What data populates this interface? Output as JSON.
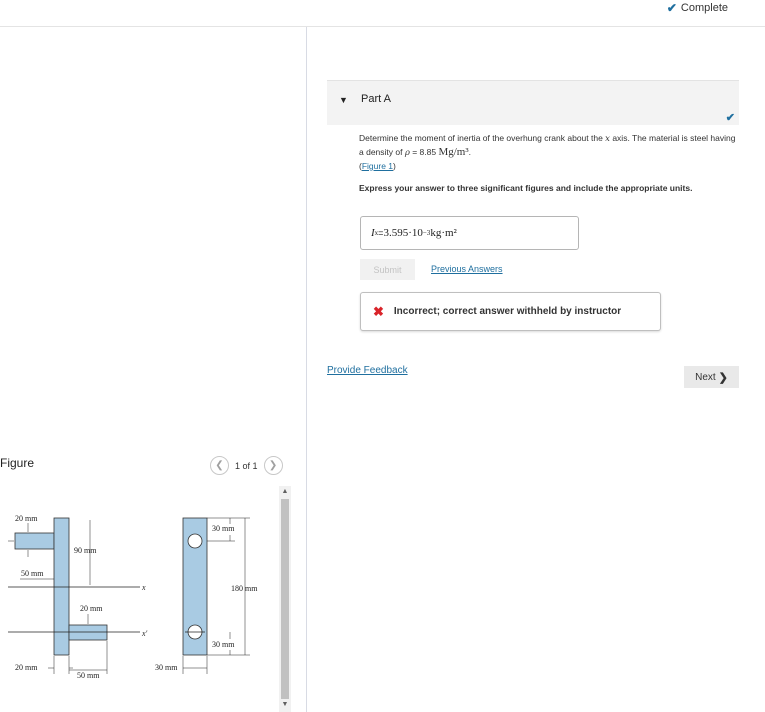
{
  "status": {
    "label": "Complete"
  },
  "part": {
    "title": "Part A"
  },
  "question": {
    "text": "Determine the moment of inertia of the overhung crank about the ",
    "axis_var": "x",
    "text2": " axis. The material is steel having a density of ",
    "rho": "ρ",
    "equals": " = 8.85 ",
    "density_unit": "Mg/m³",
    "period": ".",
    "figure_link": "Figure 1"
  },
  "instruction": "Express your answer to three significant figures and include the appropriate units.",
  "answer": {
    "var": "I",
    "sub": "x",
    "eq": " = ",
    "value": "3.595·10",
    "exp": "−3",
    "unit": " kg·m²"
  },
  "submit_label": "Submit",
  "previous_answers_label": "Previous Answers",
  "feedback": {
    "message": "Incorrect; correct answer withheld by instructor"
  },
  "provide_feedback_label": "Provide Feedback",
  "next_label": "Next",
  "figure": {
    "label": "Figure",
    "pager": "1 of 1",
    "dims": {
      "d20_top": "20 mm",
      "d90": "90 mm",
      "d50_left": "50 mm",
      "d20_mid": "20 mm",
      "d20_bottom": "20 mm",
      "d50_bottom": "50 mm",
      "d30_bottom": "30 mm",
      "d30_top_right": "30 mm",
      "d180": "180 mm",
      "d30_mid_right": "30 mm"
    },
    "axes": {
      "x": "x",
      "x_prime": "x′"
    }
  },
  "colors": {
    "accent": "#1f6f9f",
    "error": "#d9242a",
    "part_fill": "#a9cbe3"
  }
}
